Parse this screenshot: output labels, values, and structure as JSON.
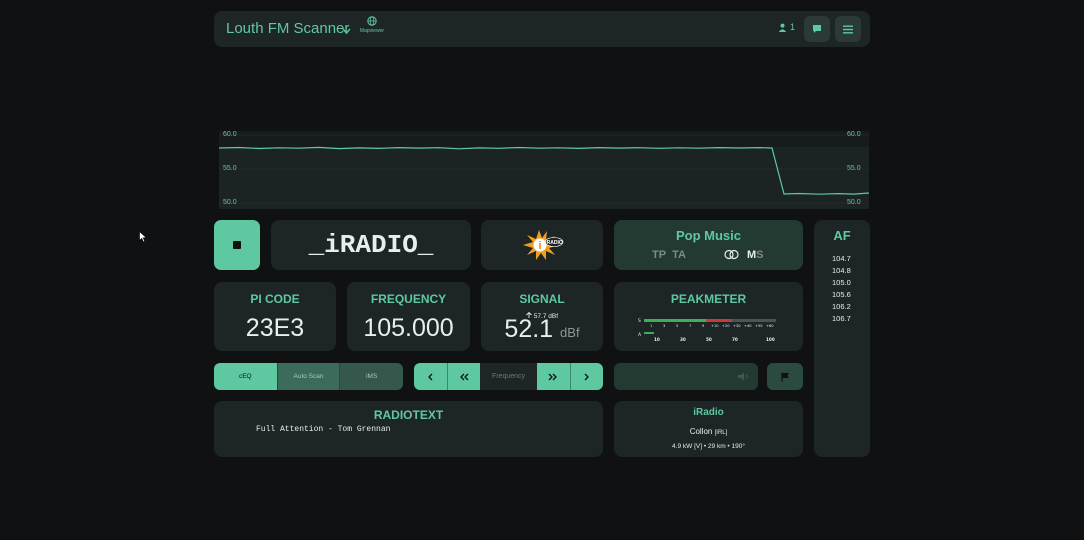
{
  "header": {
    "title": "Louth FM Scanner",
    "mapviewer_label": "Mapviewer",
    "users_count": "1"
  },
  "graph": {
    "axis_left": [
      "60.0",
      "55.0",
      "50.0"
    ],
    "axis_right": [
      "60.0",
      "55.0",
      "50.0"
    ]
  },
  "station": {
    "ps": "_iRADIO_",
    "logo_text": "iRADIO",
    "pty": "Pop Music",
    "tp": "TP",
    "ta": "TA",
    "ms": "MS",
    "ms_m": "M",
    "ms_s": "S"
  },
  "af": {
    "title": "AF",
    "items": [
      "104.7",
      "104.8",
      "105.0",
      "105.6",
      "106.2",
      "106.7"
    ]
  },
  "pi": {
    "title": "PI CODE",
    "value": "23E3"
  },
  "frequency": {
    "title": "FREQUENCY",
    "value": "105.000"
  },
  "signal": {
    "title": "SIGNAL",
    "peak": "57.7 dBf",
    "value": "52.1",
    "unit": "dBf"
  },
  "peakmeter": {
    "title": "PEAKMETER",
    "s_label": "S",
    "a_label": "A",
    "s_ticks": [
      "1",
      "3",
      "5",
      "7",
      "9",
      "+10",
      "+20",
      "+30",
      "+40",
      "+50",
      "+60"
    ],
    "a_ticks": [
      "10",
      "30",
      "50",
      "70",
      "100"
    ]
  },
  "controls": {
    "ceq": "cEQ",
    "auto_scan": "Auto Scan",
    "ims": "iMS",
    "freq_placeholder": "Frequency"
  },
  "radiotext": {
    "title": "RADIOTEXT",
    "text": "Full Attention - Tom Grennan"
  },
  "transmitter": {
    "name": "iRadio",
    "city": "Collon",
    "itu": "[IRL]",
    "info": "4.9 kW [V] • 29 km • 190°"
  },
  "colors": {
    "accent": "#5ec9a0",
    "card": "#1e2527",
    "background": "#0f1112"
  }
}
